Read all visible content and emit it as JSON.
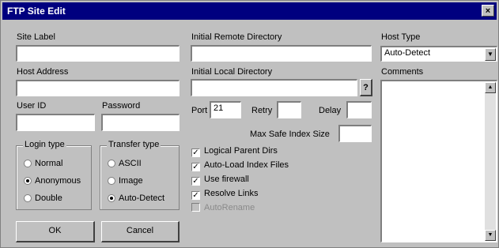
{
  "window": {
    "title": "FTP Site Edit",
    "close_glyph": "×"
  },
  "labels": {
    "site_label": "Site Label",
    "host_address": "Host Address",
    "user_id": "User ID",
    "password": "Password",
    "initial_remote_directory": "Initial Remote Directory",
    "initial_local_directory": "Initial Local Directory",
    "port": "Port",
    "retry": "Retry",
    "delay": "Delay",
    "max_safe_index_size": "Max Safe Index Size",
    "host_type": "Host Type",
    "comments": "Comments"
  },
  "fields": {
    "site_label": "",
    "host_address": "",
    "user_id": "",
    "password": "",
    "initial_remote_directory": "",
    "initial_local_directory": "",
    "port": "21",
    "retry": "",
    "delay": "",
    "max_safe_index_size": "",
    "comments": ""
  },
  "host_type": {
    "selected": "Auto-Detect"
  },
  "browse_button": "?",
  "login_type": {
    "title": "Login type",
    "options": [
      {
        "label": "Normal",
        "checked": false
      },
      {
        "label": "Anonymous",
        "checked": true
      },
      {
        "label": "Double",
        "checked": false
      }
    ]
  },
  "transfer_type": {
    "title": "Transfer type",
    "options": [
      {
        "label": "ASCII",
        "checked": false
      },
      {
        "label": "Image",
        "checked": false
      },
      {
        "label": "Auto-Detect",
        "checked": true
      }
    ]
  },
  "options": [
    {
      "label": "Logical Parent Dirs",
      "checked": true,
      "enabled": true
    },
    {
      "label": "Auto-Load Index Files",
      "checked": true,
      "enabled": true
    },
    {
      "label": "Use firewall",
      "checked": true,
      "enabled": true
    },
    {
      "label": "Resolve Links",
      "checked": true,
      "enabled": true
    },
    {
      "label": "AutoRename",
      "checked": false,
      "enabled": false
    }
  ],
  "buttons": {
    "ok": "OK",
    "cancel": "Cancel"
  },
  "icons": {
    "close": "close-icon",
    "dropdown": "chevron-down-icon",
    "scroll_up": "arrow-up-icon",
    "scroll_down": "arrow-down-icon"
  },
  "colors": {
    "titlebar": "#00007f",
    "face": "#c0c0c0"
  }
}
